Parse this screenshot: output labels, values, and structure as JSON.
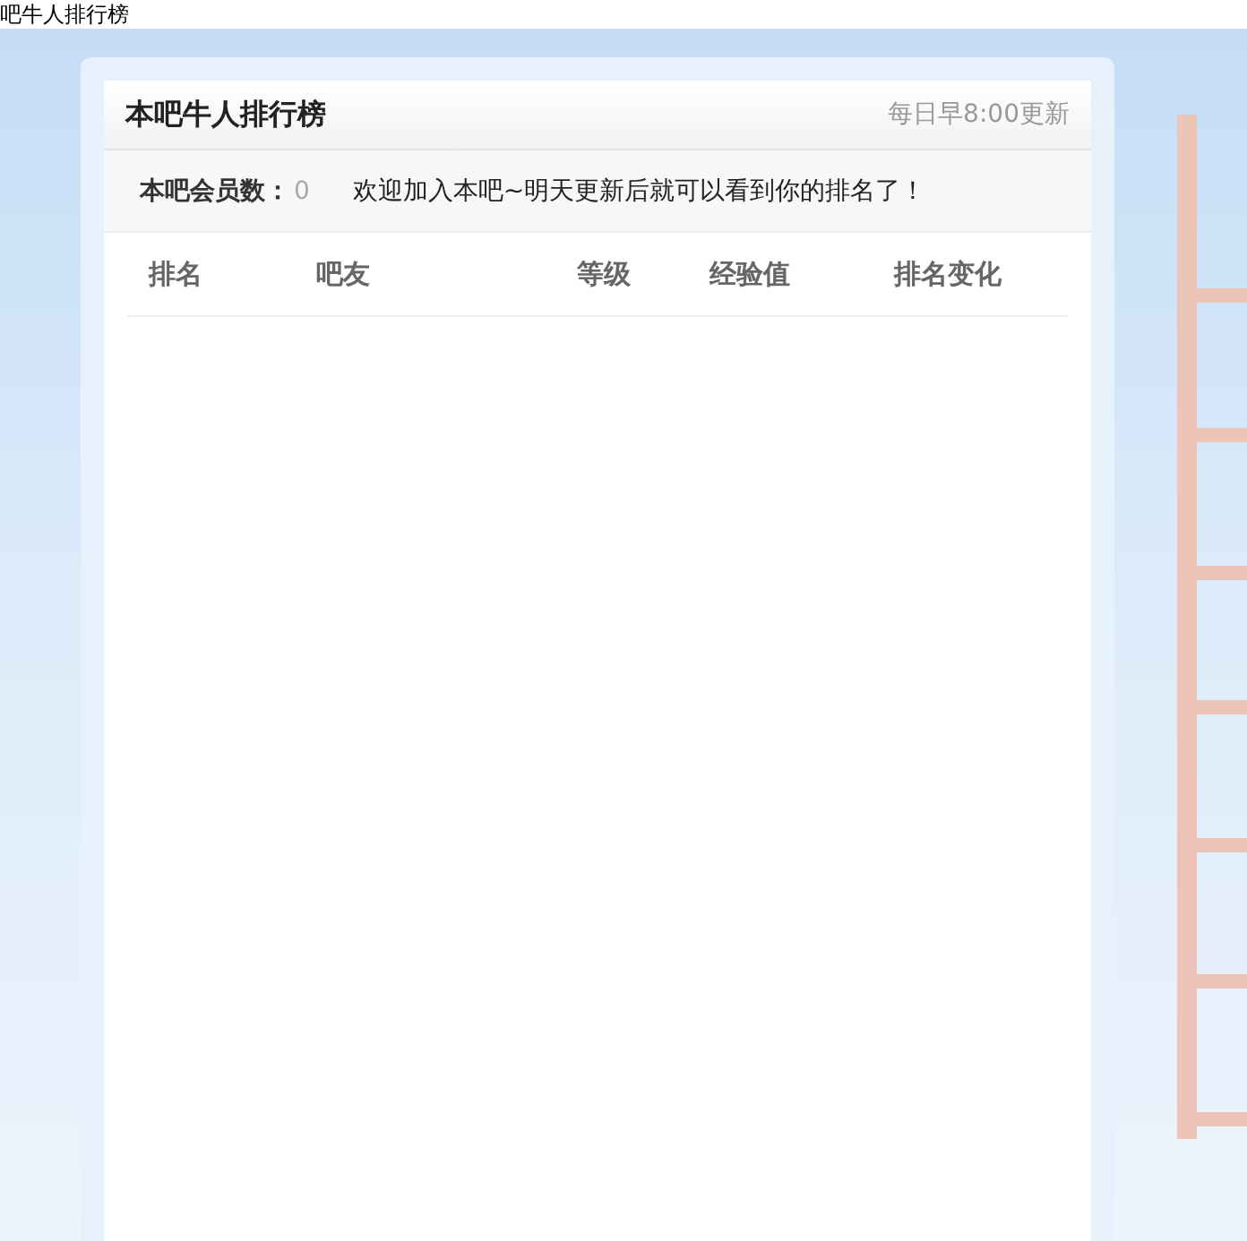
{
  "page_title": "吧牛人排行榜",
  "panel": {
    "title": "本吧牛人排行榜",
    "update_note": "每日早8:00更新",
    "member_label": "本吧会员数：",
    "member_count": "0",
    "welcome": "欢迎加入本吧~明天更新后就可以看到你的排名了！"
  },
  "table": {
    "columns": [
      "排名",
      "吧友",
      "等级",
      "经验值",
      "排名变化"
    ]
  }
}
